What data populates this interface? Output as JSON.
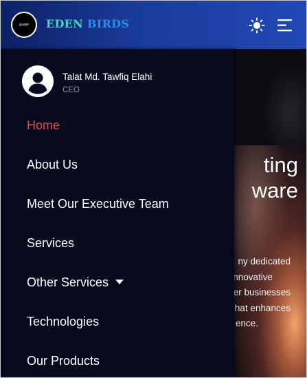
{
  "header": {
    "brand_part1": "EDEN",
    "brand_part2": "BIRDS",
    "logo_icon": "logo-icon",
    "theme_toggle_icon": "sun-icon",
    "menu_icon": "menu-lines-icon"
  },
  "drawer": {
    "user": {
      "name": "Talat Md. Tawfiq Elahi",
      "role": "CEO",
      "avatar_icon": "user-avatar-icon"
    },
    "items": [
      {
        "label": "Home",
        "active": true
      },
      {
        "label": "About Us",
        "active": false
      },
      {
        "label": "Meet Our Executive Team",
        "active": false
      },
      {
        "label": "Services",
        "active": false
      },
      {
        "label": "Other Services",
        "active": false,
        "dropdown": true,
        "icon": "caret-down-icon"
      },
      {
        "label": "Technologies",
        "active": false
      },
      {
        "label": "Our Products",
        "active": false
      }
    ]
  },
  "hero": {
    "heading_lines": [
      "ting",
      "ware"
    ],
    "paragraph_lines": [
      "ny dedicated",
      "nnovative",
      "er businesses",
      "hat enhances",
      "ence."
    ]
  },
  "colors": {
    "header_gradient_start": "#0d2165",
    "header_gradient_end": "#2248b5",
    "drawer_background": "#070a1c",
    "active_item": "#e34b4b",
    "brand_part1": "#4fd1c5",
    "brand_part2": "#2b8cf0"
  }
}
